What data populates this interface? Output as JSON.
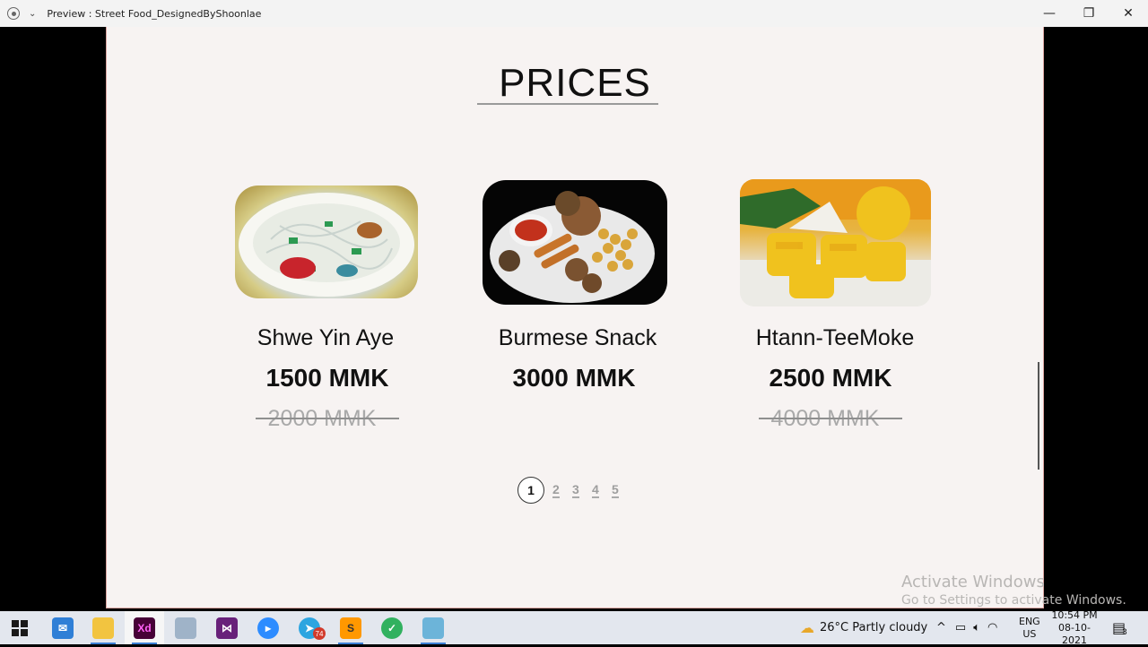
{
  "window": {
    "title": "Preview : Street Food_DesignedByShoonlae",
    "minimize": "—",
    "restore": "❐",
    "close": "✕"
  },
  "page": {
    "heading": "PRICES",
    "items": [
      {
        "name": "Shwe Yin Aye",
        "price": "1500 MMK",
        "old_price": "2000 MMK"
      },
      {
        "name": "Burmese Snack",
        "price": "3000 MMK",
        "old_price": ""
      },
      {
        "name": "Htann-TeeMoke",
        "price": "2500 MMK",
        "old_price": "4000 MMK"
      }
    ],
    "pagination": [
      "1",
      "2",
      "3",
      "4",
      "5"
    ],
    "active_page": "1"
  },
  "watermark": {
    "line1": "Activate Windows",
    "line2": "Go to Settings to activate Windows."
  },
  "taskbar": {
    "apps": [
      "windows-start",
      "mail",
      "file-explorer",
      "adobe-xd",
      "tool",
      "visual-studio",
      "zoom",
      "telegram",
      "sublime-text",
      "vpn",
      "notes"
    ],
    "adobe_xd_label": "Xd",
    "telegram_badge": "74",
    "weather": "26°C  Partly cloudy",
    "language": "ENG",
    "region": "US",
    "time": "10:54 PM",
    "date": "08-10-2021",
    "notification_count": "3"
  }
}
